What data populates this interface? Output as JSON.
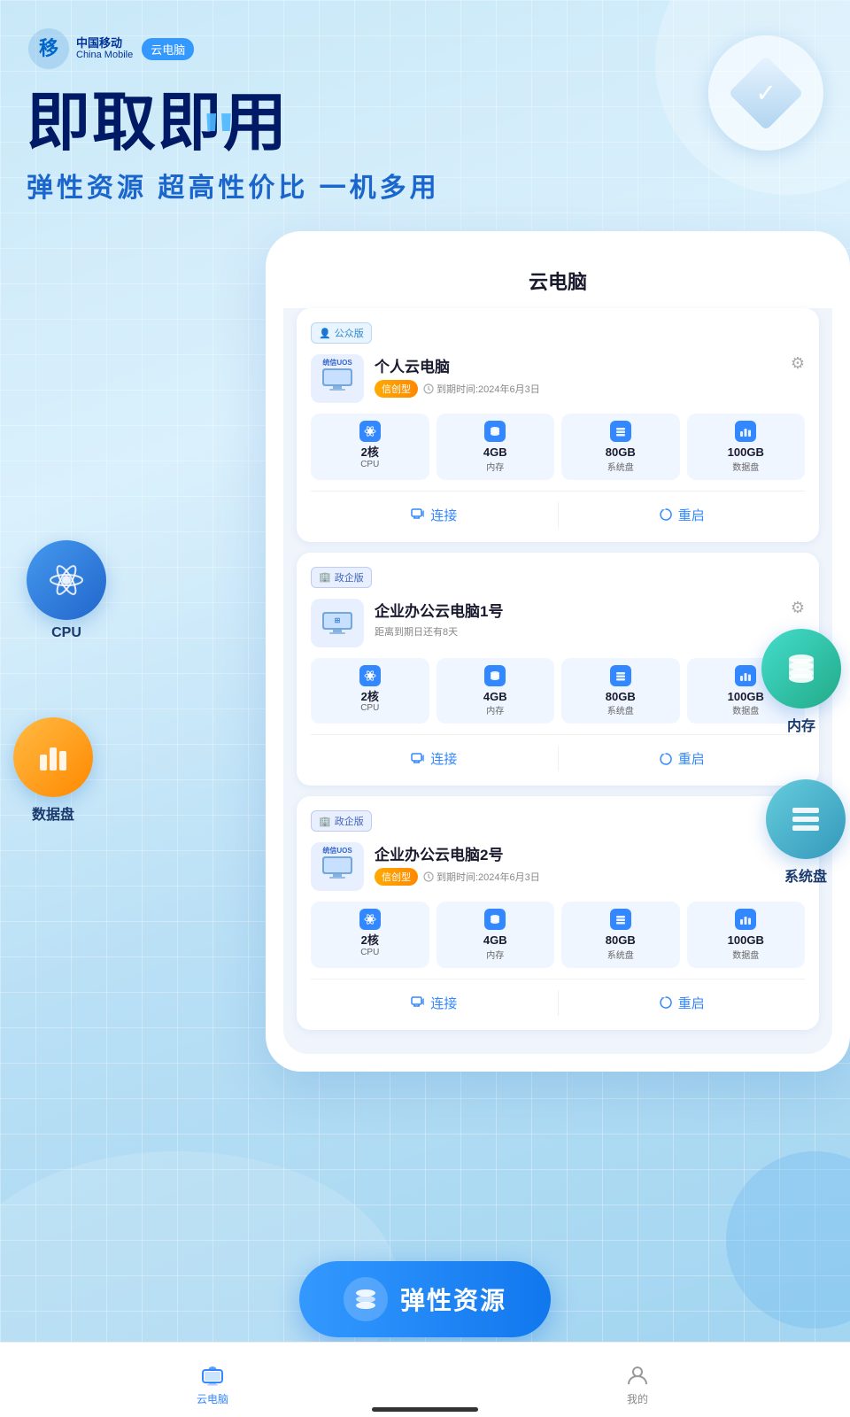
{
  "app": {
    "brand_cn": "中国移动",
    "brand_en": "China Mobile",
    "product_tag": "云电脑",
    "hero_title": "即取即用",
    "hero_quote": "\"",
    "hero_subtitle": "弹性资源 超高性价比 一机多用",
    "screen_title": "云电脑"
  },
  "float_icons": {
    "cpu_label": "CPU",
    "data_disk_label": "数据盘",
    "memory_label": "内存",
    "sys_disk_label": "系统盘"
  },
  "cards": [
    {
      "badge": "公众版",
      "badge_icon": "👤",
      "name": "个人云电脑",
      "tag": "信创型",
      "expire": "到期时间:2024年6月3日",
      "icon_label": "统信UOS",
      "specs": [
        {
          "icon": "⚛",
          "value": "2核",
          "unit": "CPU"
        },
        {
          "icon": "🗄",
          "value": "4GB",
          "unit": "内存"
        },
        {
          "icon": "☰",
          "value": "80GB",
          "unit": "系统盘"
        },
        {
          "icon": "📊",
          "value": "100GB",
          "unit": "数据盘"
        }
      ],
      "actions": [
        "连接",
        "重启"
      ]
    },
    {
      "badge": "政企版",
      "badge_icon": "🏢",
      "name": "企业办公云电脑1号",
      "tag": null,
      "expire": "距离到期日还有8天",
      "icon_label": "Windows",
      "specs": [
        {
          "icon": "⚛",
          "value": "2核",
          "unit": "CPU"
        },
        {
          "icon": "🗄",
          "value": "4GB",
          "unit": "内存"
        },
        {
          "icon": "☰",
          "value": "80GB",
          "unit": "系统盘"
        },
        {
          "icon": "📊",
          "value": "100GB",
          "unit": "数据盘"
        }
      ],
      "actions": [
        "连接",
        "重启"
      ]
    },
    {
      "badge": "政企版",
      "badge_icon": "🏢",
      "name": "企业办公云电脑2号",
      "tag": "信创型",
      "expire": "到期时间:2024年6月3日",
      "icon_label": "统信UOS",
      "specs": [
        {
          "icon": "⚛",
          "value": "2核",
          "unit": "CPU"
        },
        {
          "icon": "🗄",
          "value": "4GB",
          "unit": "内存"
        },
        {
          "icon": "☰",
          "value": "80GB",
          "unit": "系统盘"
        },
        {
          "icon": "📊",
          "value": "100GB",
          "unit": "数据盘"
        }
      ],
      "actions": [
        "连接",
        "重启"
      ]
    }
  ],
  "elastic_btn": {
    "label": "弹性资源"
  },
  "bottom_nav": [
    {
      "label": "云电脑",
      "active": true
    },
    {
      "label": "我的",
      "active": false
    }
  ]
}
